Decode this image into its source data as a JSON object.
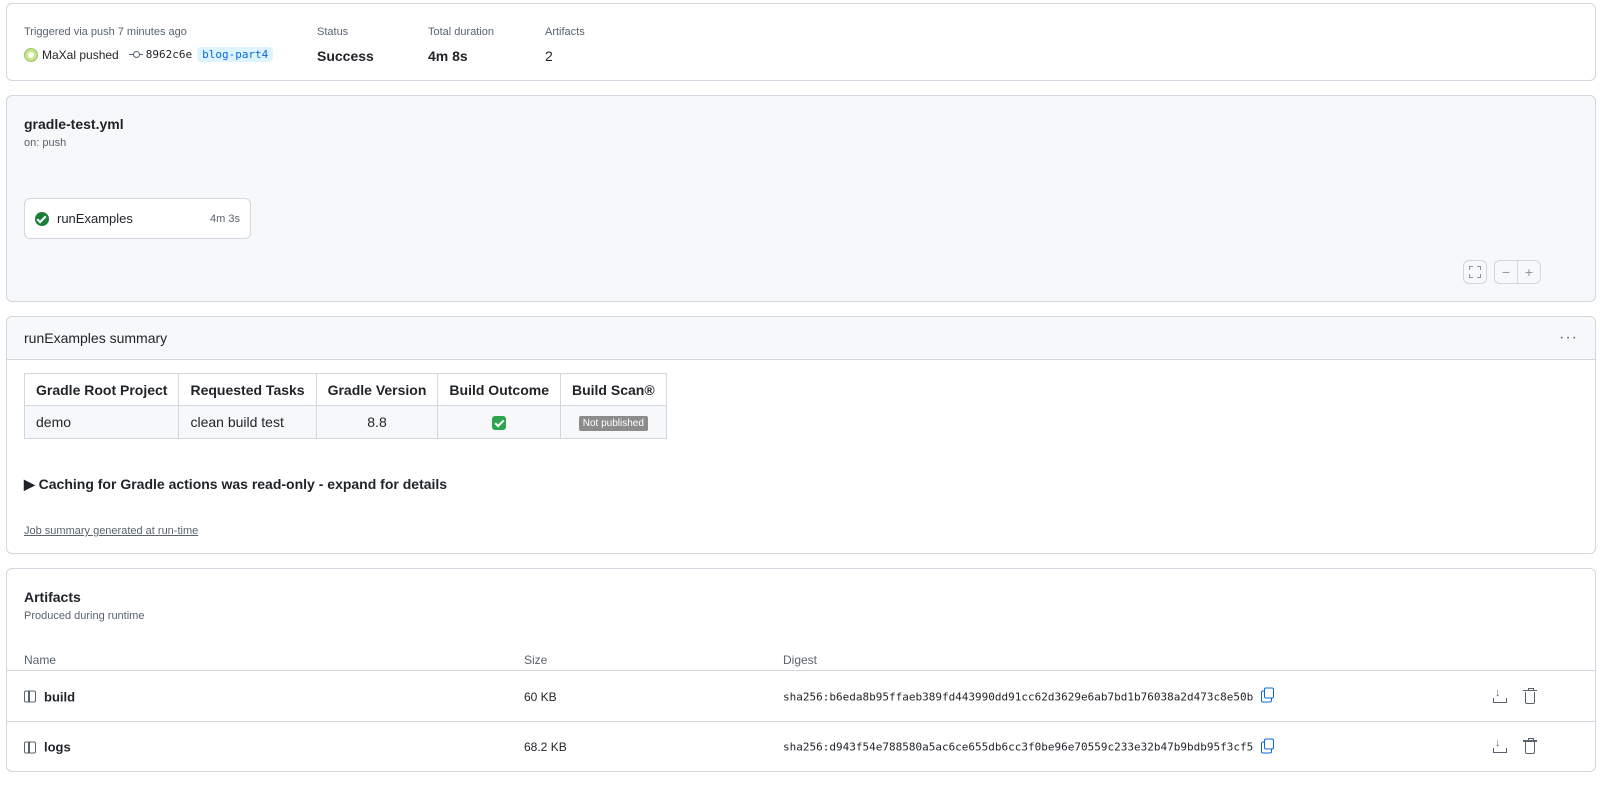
{
  "run": {
    "trigger_label": "Triggered via push 7 minutes ago",
    "actor": "MaXal pushed",
    "commit_sha": "8962c6e",
    "branch": "blog-part4",
    "status_label": "Status",
    "status_value": "Success",
    "duration_label": "Total duration",
    "duration_value": "4m 8s",
    "artifacts_label": "Artifacts",
    "artifacts_value": "2"
  },
  "workflow": {
    "file": "gradle-test.yml",
    "trigger": "on: push",
    "job": {
      "name": "runExamples",
      "duration": "4m 3s",
      "status": "success"
    },
    "controls": {
      "zoom_out": "−",
      "zoom_in": "+"
    }
  },
  "summary": {
    "title": "runExamples summary",
    "menu": "···",
    "table": {
      "headers": [
        "Gradle Root Project",
        "Requested Tasks",
        "Gradle Version",
        "Build Outcome",
        "Build Scan®"
      ],
      "row": {
        "project": "demo",
        "tasks": "clean build test",
        "version": "8.8",
        "outcome": "success",
        "scan": "Not published"
      }
    },
    "details": "▶ Caching for Gradle actions was read-only - expand for details",
    "footnote": "Job summary generated at run-time"
  },
  "artifacts": {
    "title": "Artifacts",
    "subtitle": "Produced during runtime",
    "columns": {
      "name": "Name",
      "size": "Size",
      "digest": "Digest"
    },
    "items": [
      {
        "name": "build",
        "size": "60 KB",
        "digest": "sha256:b6eda8b95ffaeb389fd443990dd91cc62d3629e6ab7bd1b76038a2d473c8e50b"
      },
      {
        "name": "logs",
        "size": "68.2 KB",
        "digest": "sha256:d943f54e788580a5ac6ce655db6cc3f0be96e70559c233e32b47b9bdb95f3cf5"
      }
    ]
  },
  "colors": {
    "success": "#1a7f37",
    "link": "#0969da",
    "border": "#d0d7de",
    "muted": "#59636e"
  }
}
